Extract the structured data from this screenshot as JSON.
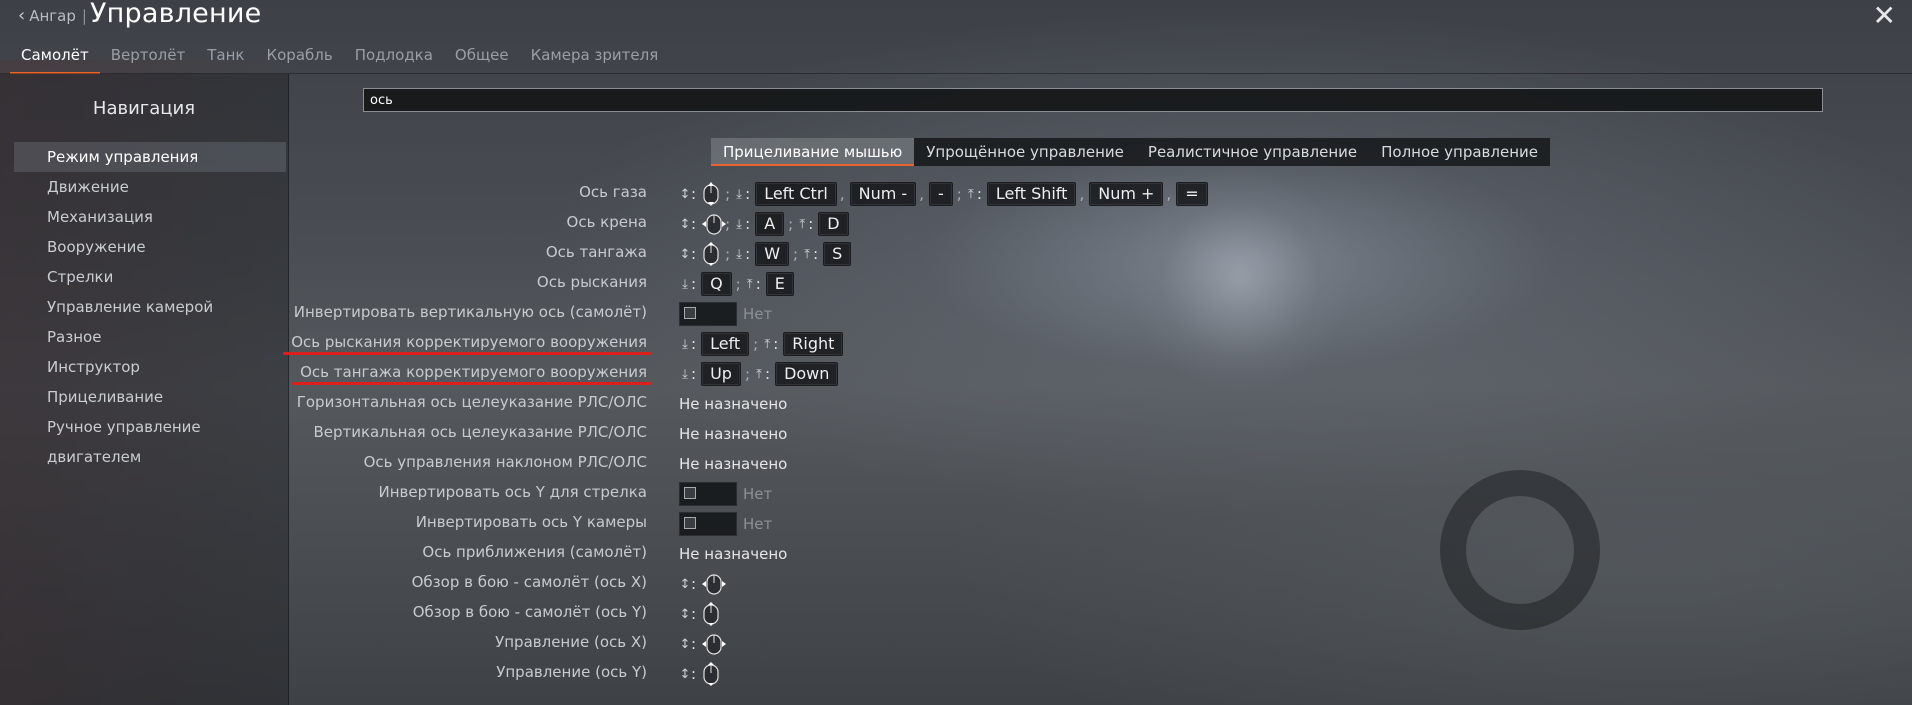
{
  "header": {
    "back_label": "Ангар",
    "back_separator": "|",
    "title": "Управление"
  },
  "tabs": [
    {
      "label": "Самолёт",
      "active": true
    },
    {
      "label": "Вертолёт",
      "active": false
    },
    {
      "label": "Танк",
      "active": false
    },
    {
      "label": "Корабль",
      "active": false
    },
    {
      "label": "Подлодка",
      "active": false
    },
    {
      "label": "Общее",
      "active": false
    },
    {
      "label": "Камера зрителя",
      "active": false
    }
  ],
  "nav": {
    "title": "Навигация",
    "items": [
      {
        "label": "Режим управления",
        "active": true
      },
      {
        "label": "Движение"
      },
      {
        "label": "Механизация"
      },
      {
        "label": "Вооружение"
      },
      {
        "label": "Стрелки"
      },
      {
        "label": "Управление камерой"
      },
      {
        "label": "Разное"
      },
      {
        "label": "Инструктор"
      },
      {
        "label": "Прицеливание"
      },
      {
        "label": "Ручное управление двигателем"
      }
    ]
  },
  "search": {
    "value": "ось"
  },
  "modes": [
    {
      "label": "Прицеливание мышью",
      "active": true
    },
    {
      "label": "Упрощённое управление"
    },
    {
      "label": "Реалистичное управление"
    },
    {
      "label": "Полное управление"
    }
  ],
  "icons": {
    "axis": "↕",
    "decrease": "⤓",
    "increase": "⤒"
  },
  "common": {
    "not_assigned": "Не назначено",
    "no": "Нет",
    "colon": ":",
    "semicolon": ";",
    "comma": ","
  },
  "keys": {
    "left_ctrl": "Left Ctrl",
    "num_minus": "Num -",
    "minus": "-",
    "left_shift": "Left Shift",
    "num_plus": "Num +",
    "equals": "=",
    "a": "A",
    "d": "D",
    "w": "W",
    "s": "S",
    "q": "Q",
    "e": "E",
    "left": "Left",
    "right": "Right",
    "up": "Up",
    "down": "Down"
  },
  "rows": [
    {
      "label": "Ось газа"
    },
    {
      "label": "Ось крена"
    },
    {
      "label": "Ось тангажа"
    },
    {
      "label": "Ось рыскания"
    },
    {
      "label": "Инвертировать вертикальную ось (самолёт)"
    },
    {
      "label": "Ось рыскания корректируемого вооружения",
      "marked": true
    },
    {
      "label": "Ось тангажа корректируемого вооружения",
      "marked": true
    },
    {
      "label": "Горизонтальная ось целеуказание РЛС/ОЛС"
    },
    {
      "label": "Вертикальная ось целеуказание РЛС/ОЛС"
    },
    {
      "label": "Ось управления наклоном РЛС/ОЛС"
    },
    {
      "label": "Инвертировать ось Y для стрелка"
    },
    {
      "label": "Инвертировать ось Y камеры"
    },
    {
      "label": "Ось приближения (самолёт)"
    },
    {
      "label": "Обзор в бою - самолёт (ось X)"
    },
    {
      "label": "Обзор в бою - самолёт (ось Y)"
    },
    {
      "label": "Управление (ось X)"
    },
    {
      "label": "Управление (ось Y)"
    }
  ]
}
